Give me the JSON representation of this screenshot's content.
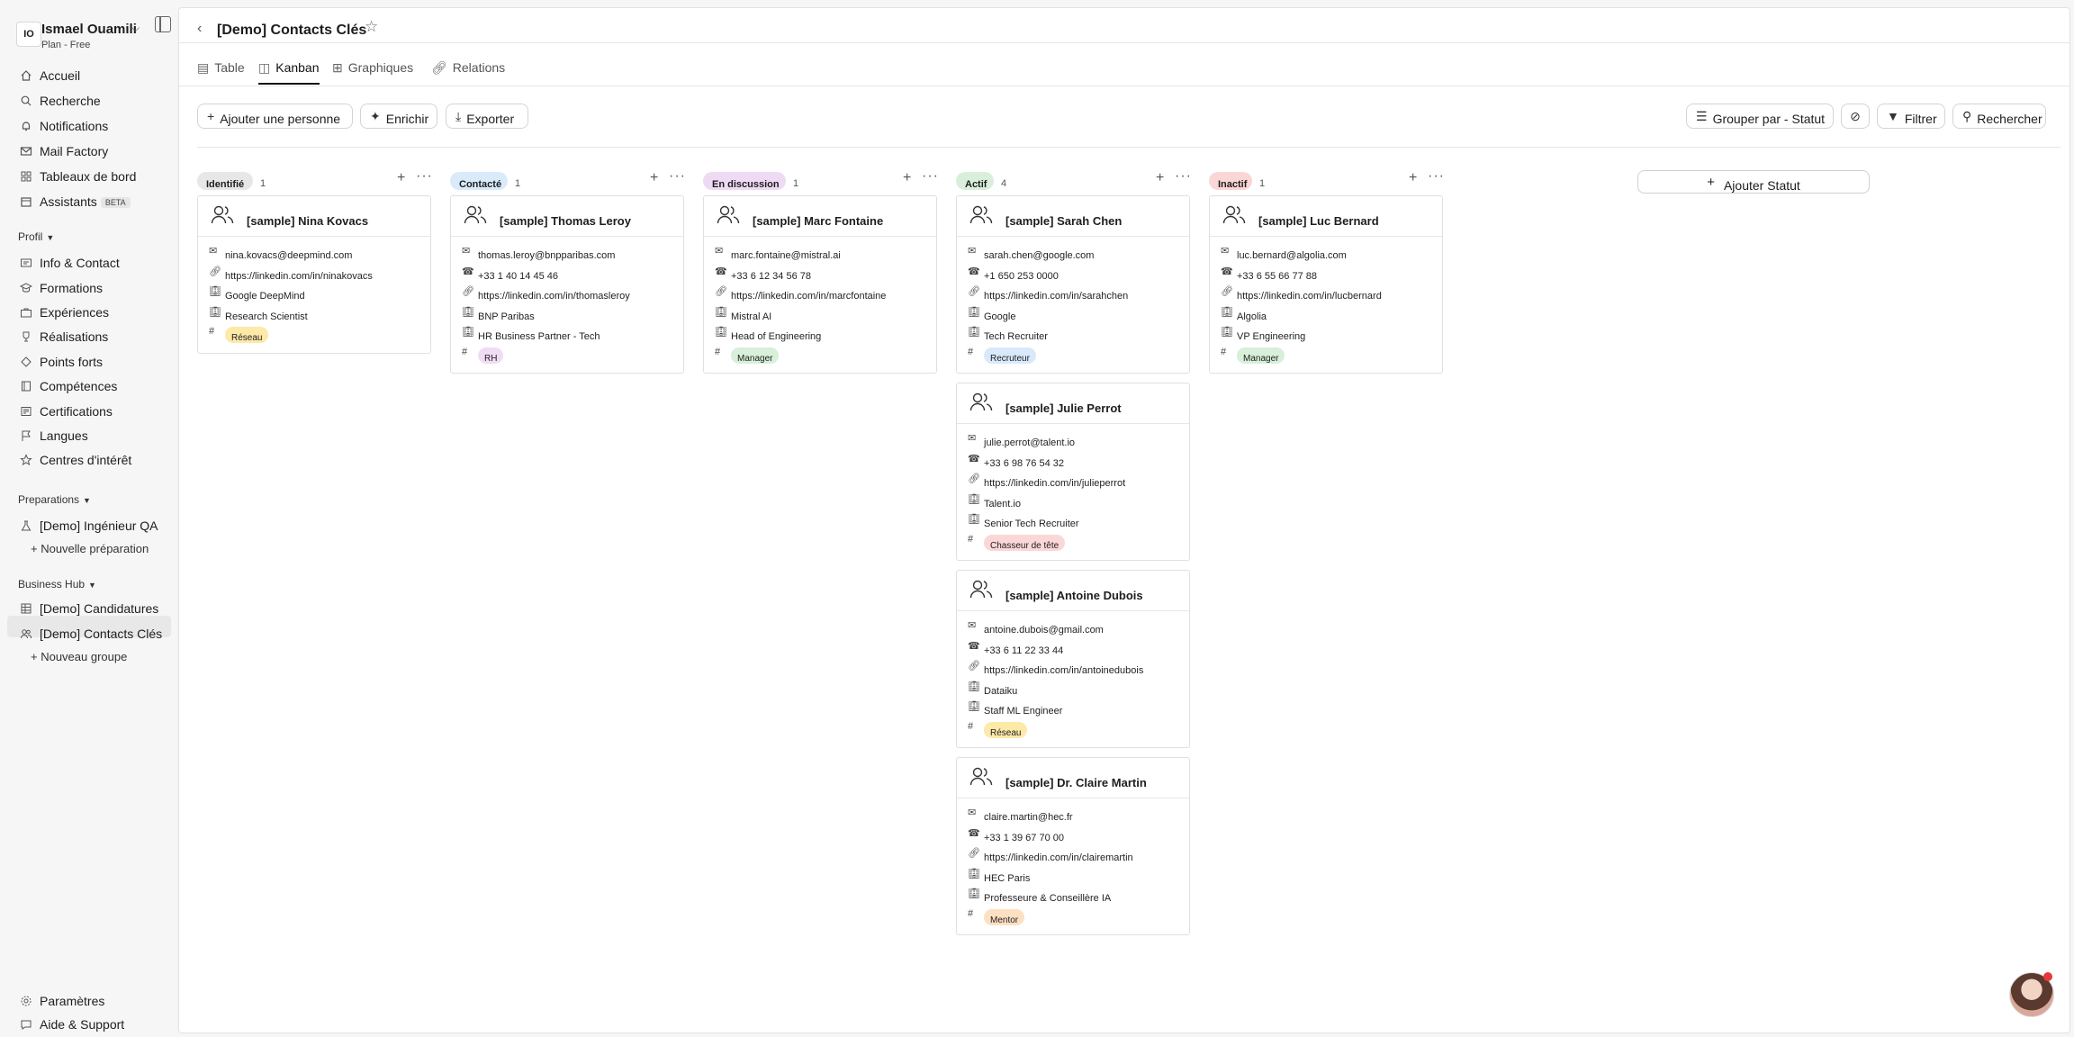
{
  "sidebar": {
    "user": {
      "initials": "IO",
      "name": "Ismael Ouamili",
      "plan": "Plan - Free"
    },
    "nav": [
      {
        "label": "Accueil",
        "icon": "home-icon"
      },
      {
        "label": "Recherche",
        "icon": "search-icon"
      },
      {
        "label": "Notifications",
        "icon": "bell-icon"
      },
      {
        "label": "Mail Factory",
        "icon": "mail-icon"
      },
      {
        "label": "Tableaux de bord",
        "icon": "grid-icon"
      },
      {
        "label": "Assistants",
        "icon": "calendar-icon",
        "badge": "BETA"
      }
    ],
    "profil_title": "Profil",
    "profil": [
      {
        "label": "Info & Contact"
      },
      {
        "label": "Formations"
      },
      {
        "label": "Expériences"
      },
      {
        "label": "Réalisations"
      },
      {
        "label": "Points forts"
      },
      {
        "label": "Compétences"
      },
      {
        "label": "Certifications"
      },
      {
        "label": "Langues"
      },
      {
        "label": "Centres d'intérêt"
      }
    ],
    "preparations_title": "Preparations",
    "preparations": [
      {
        "label": "[Demo] Ingénieur QA"
      }
    ],
    "new_preparation": "+ Nouvelle préparation",
    "business_title": "Business Hub",
    "business": [
      {
        "label": "[Demo] Candidatures"
      },
      {
        "label": "[Demo] Contacts Clés"
      }
    ],
    "new_group": "+ Nouveau groupe",
    "settings": "Paramètres",
    "help": "Aide & Support"
  },
  "header": {
    "title": "[Demo] Contacts Clés"
  },
  "tabs": [
    "Table",
    "Kanban",
    "Graphiques",
    "Relations"
  ],
  "toolbar": {
    "add_person": "Ajouter une personne",
    "enrich": "Enrichir",
    "export": "Exporter",
    "group_by": "Grouper par - Statut",
    "filter": "Filtrer",
    "search": "Rechercher"
  },
  "add_status": "Ajouter Statut",
  "columns": [
    {
      "status": "Identifié",
      "count": "1",
      "color": "#e7e7e7"
    },
    {
      "status": "Contacté",
      "count": "1",
      "color": "#d9ebfb"
    },
    {
      "status": "En discussion",
      "count": "1",
      "color": "#efdaf4"
    },
    {
      "status": "Actif",
      "count": "4",
      "color": "#d9efdc"
    },
    {
      "status": "Inactif",
      "count": "1",
      "color": "#fbd6d6"
    }
  ],
  "cards": [
    {
      "name": "[sample] Nina Kovacs",
      "email": "nina.kovacs@deepmind.com",
      "linkedin": "https://linkedin.com/in/ninakovacs",
      "company": "Google DeepMind",
      "title": "Research Scientist",
      "tag": "Réseau",
      "tag_color": "#fde9a8"
    },
    {
      "name": "[sample] Thomas Leroy",
      "email": "thomas.leroy@bnpparibas.com",
      "phone": "+33 1 40 14 45 46",
      "linkedin": "https://linkedin.com/in/thomasleroy",
      "company": "BNP Paribas",
      "title": "HR Business Partner - Tech",
      "tag": "RH",
      "tag_color": "#f0dcf5"
    },
    {
      "name": "[sample] Marc Fontaine",
      "email": "marc.fontaine@mistral.ai",
      "phone": "+33 6 12 34 56 78",
      "linkedin": "https://linkedin.com/in/marcfontaine",
      "company": "Mistral AI",
      "title": "Head of Engineering",
      "tag": "Manager",
      "tag_color": "#d8efd9"
    },
    {
      "name": "[sample] Sarah Chen",
      "email": "sarah.chen@google.com",
      "phone": "+1 650 253 0000",
      "linkedin": "https://linkedin.com/in/sarahchen",
      "company": "Google",
      "title": "Tech Recruiter",
      "tag": "Recruteur",
      "tag_color": "#d9e9fb"
    },
    {
      "name": "[sample] Luc Bernard",
      "email": "luc.bernard@algolia.com",
      "phone": "+33 6 55 66 77 88",
      "linkedin": "https://linkedin.com/in/lucbernard",
      "company": "Algolia",
      "title": "VP Engineering",
      "tag": "Manager",
      "tag_color": "#d8efd9"
    },
    {
      "name": "[sample] Julie Perrot",
      "email": "julie.perrot@talent.io",
      "phone": "+33 6 98 76 54 32",
      "linkedin": "https://linkedin.com/in/julieperrot",
      "company": "Talent.io",
      "title": "Senior Tech Recruiter",
      "tag": "Chasseur de tête",
      "tag_color": "#fbd7d7"
    },
    {
      "name": "[sample] Antoine Dubois",
      "email": "antoine.dubois@gmail.com",
      "phone": "+33 6 11 22 33 44",
      "linkedin": "https://linkedin.com/in/antoinedubois",
      "company": "Dataiku",
      "title": "Staff ML Engineer",
      "tag": "Réseau",
      "tag_color": "#fde9a8"
    },
    {
      "name": "[sample] Dr. Claire Martin",
      "email": "claire.martin@hec.fr",
      "phone": "+33 1 39 67 70 00",
      "linkedin": "https://linkedin.com/in/clairemartin",
      "company": "HEC Paris",
      "title": "Professeure & Conseillère IA",
      "tag": "Mentor",
      "tag_color": "#fde0c2"
    }
  ]
}
